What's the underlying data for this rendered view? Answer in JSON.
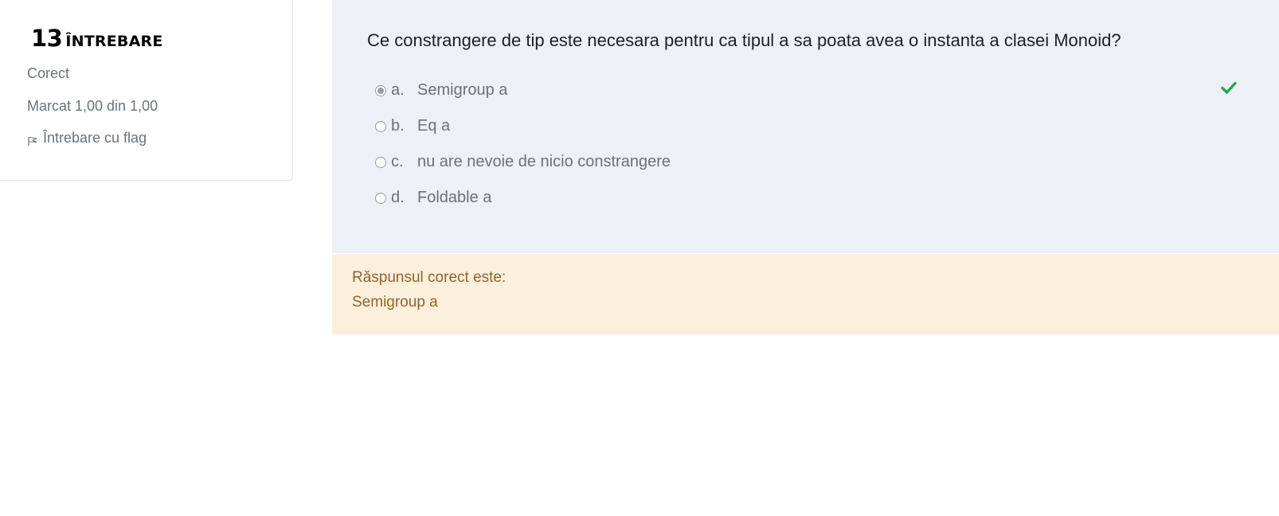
{
  "info": {
    "question_number": "13",
    "question_label": "ÎNTREBARE",
    "state": "Corect",
    "grade": "Marcat 1,00 din 1,00",
    "flag_label": "Întrebare cu flag",
    "flag_icon": "flag-icon"
  },
  "question": {
    "text": "Ce constrangere de tip este necesara pentru ca tipul a sa poata avea o instanta a clasei Monoid?",
    "answers": [
      {
        "letter": "a.",
        "text": "Semigroup a",
        "selected": true
      },
      {
        "letter": "b.",
        "text": "Eq a",
        "selected": false
      },
      {
        "letter": "c.",
        "text": "nu are nevoie de nicio constrangere",
        "selected": false
      },
      {
        "letter": "d.",
        "text": "Foldable a",
        "selected": false
      }
    ],
    "correct_icon": "check-icon",
    "correct_icon_color": "#2ea44f"
  },
  "feedback": {
    "label": "Răspunsul corect este:",
    "answer": "Semigroup a"
  },
  "colors": {
    "question_bg": "#edf0f6",
    "feedback_bg": "#fcefdc",
    "feedback_text": "#8e662e"
  }
}
